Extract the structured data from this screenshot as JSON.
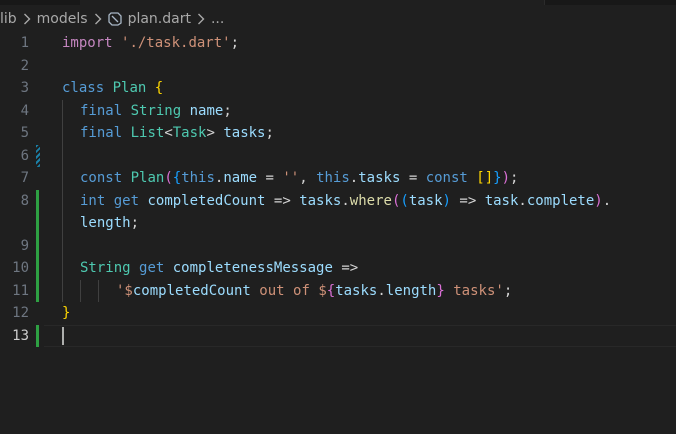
{
  "breadcrumb": {
    "folder1": "lib",
    "folder2": "models",
    "file": "plan.dart",
    "more": "..."
  },
  "editor": {
    "language": "dart",
    "current_line": 13,
    "line_numbers": [
      "1",
      "2",
      "3",
      "4",
      "5",
      "6",
      "7",
      "8",
      "",
      "9",
      "10",
      "11",
      "12",
      "13"
    ],
    "tokens": {
      "l1_import": "import",
      "l1_str": "'./task.dart'",
      "l1_semi": ";",
      "l3_class": "class",
      "l3_name": "Plan",
      "l3_brace": "{",
      "l4_final": "final",
      "l4_type": "String",
      "l4_name": "name",
      "l4_semi": ";",
      "l5_final": "final",
      "l5_type": "List",
      "l5_lt": "<",
      "l5_typearg": "Task",
      "l5_gt": ">",
      "l5_name": "tasks",
      "l5_semi": ";",
      "l7_const": "const",
      "l7_ctor": "Plan",
      "l7_paren_open": "(",
      "l7_brace_open": "{",
      "l7_this1": "this",
      "l7_dot1": ".",
      "l7_name": "name",
      "l7_eq1": " = ",
      "l7_empty": "''",
      "l7_comma": ", ",
      "l7_this2": "this",
      "l7_dot2": ".",
      "l7_tasks": "tasks",
      "l7_eq2": " = ",
      "l7_const2": "const",
      "l7_list": "[]",
      "l7_brace_close": "}",
      "l7_paren_close": ")",
      "l7_semi": ";",
      "l8_int": "int",
      "l8_get": "get",
      "l8_name": "completedCount",
      "l8_arrow": " => ",
      "l8_tasks": "tasks",
      "l8_dot": ".",
      "l8_where": "where",
      "l8_p1": "(",
      "l8_p2": "(",
      "l8_param": "task",
      "l8_p2c": ")",
      "l8_arrow2": " => ",
      "l8_task": "task",
      "l8_dot2": ".",
      "l8_complete": "complete",
      "l8_p1c": ")",
      "l8_dot3": ".",
      "l8w_length": "length",
      "l8w_semi": ";",
      "l10_type": "String",
      "l10_get": "get",
      "l10_name": "completenessMessage",
      "l10_arrow": " =>",
      "l11_q1": "'$",
      "l11_var": "completedCount",
      "l11_mid": " out of ",
      "l11_dollar": "$",
      "l11_b_open": "{",
      "l11_tasks": "tasks",
      "l11_dot": ".",
      "l11_length": "length",
      "l11_b_close": "}",
      "l11_end": " tasks'",
      "l11_semi": ";",
      "l12_brace": "}"
    }
  },
  "colors": {
    "background": "#1f1f1f",
    "keyword": "#569cd6",
    "control": "#c586c0",
    "string": "#ce9178",
    "type": "#4ec9b0",
    "identifier": "#9cdcfe",
    "function": "#dcdcaa",
    "added_marker": "#2ea043",
    "modified_marker": "#1b81a8"
  },
  "icons": [
    "chevron-right-icon",
    "dart-file-icon"
  ]
}
